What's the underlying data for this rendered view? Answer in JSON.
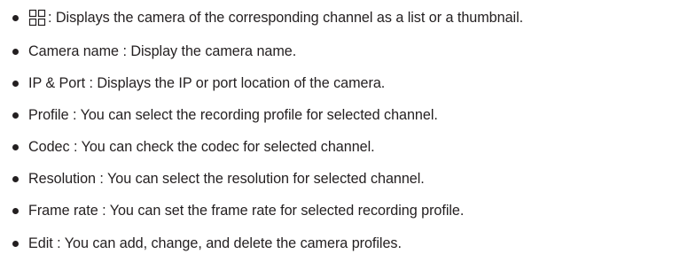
{
  "icons": {
    "view_toggle": "grid-view-icon"
  },
  "items": [
    {
      "label": ": Displays the camera of the corresponding channel as a list or a thumbnail."
    },
    {
      "label": "Camera name : Display the camera name."
    },
    {
      "label": "IP & Port : Displays the IP or port location of the camera."
    },
    {
      "label": "Profile : You can select the recording profile for selected channel."
    },
    {
      "label": "Codec : You can check the codec for selected channel."
    },
    {
      "label": "Resolution : You can select the resolution for selected channel."
    },
    {
      "label": "Frame rate : You can set the frame rate for selected recording profile."
    },
    {
      "label": "Edit : You can add, change, and delete the camera profiles."
    }
  ],
  "colors": {
    "text": "#231f20",
    "background": "#ffffff"
  }
}
